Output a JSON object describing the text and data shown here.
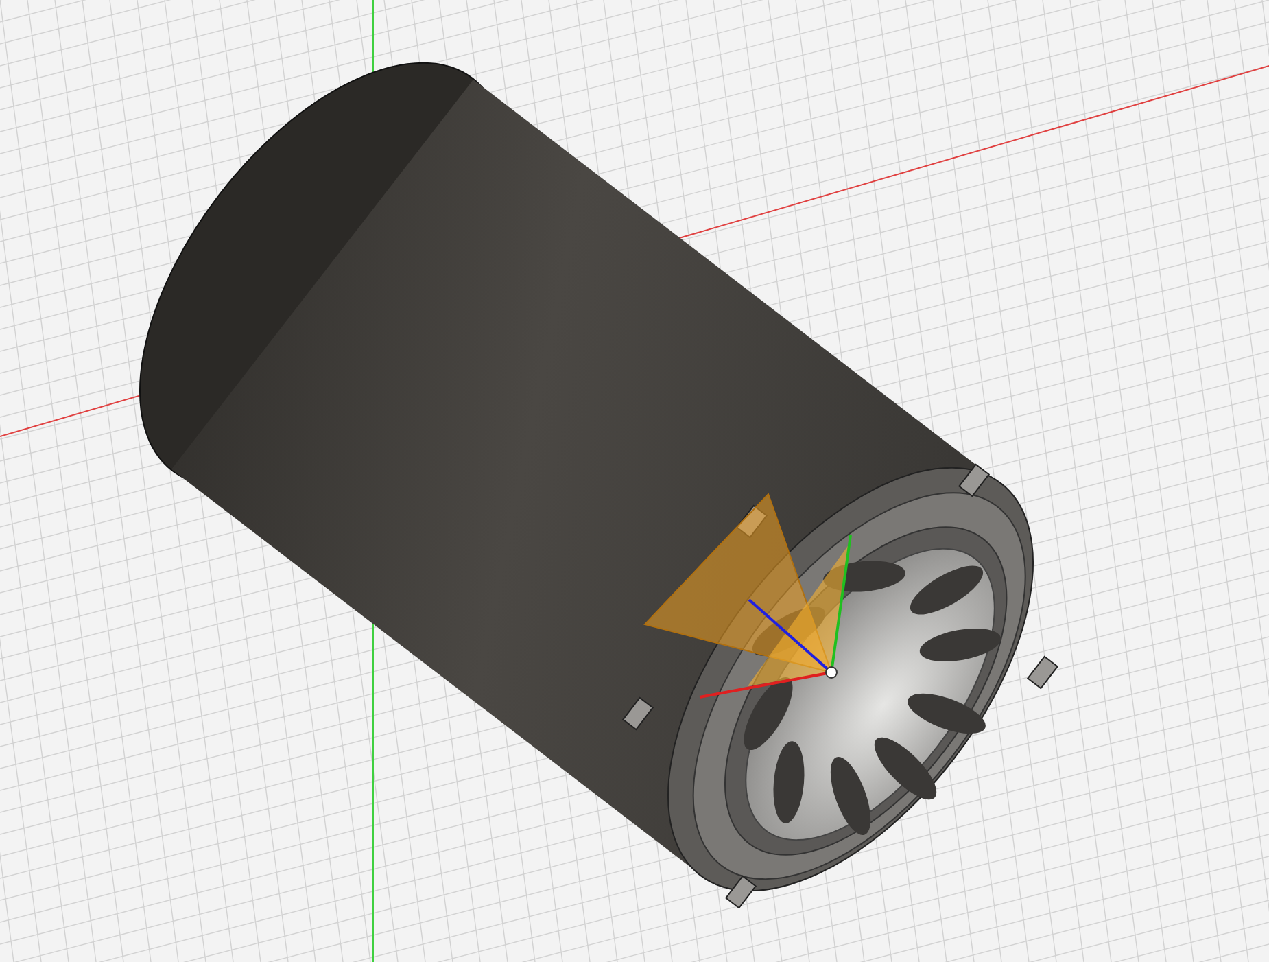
{
  "viewport": {
    "kind": "cad-model"
  }
}
